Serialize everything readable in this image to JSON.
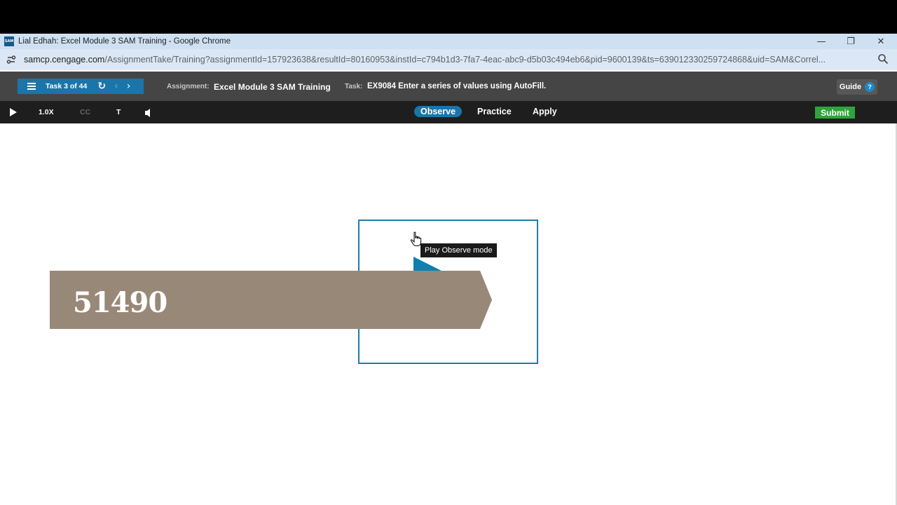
{
  "window": {
    "favicon_text": "SAM",
    "title": "Lial Edhah: Excel Module 3 SAM Training - Google Chrome",
    "minimize": "—",
    "restore": "❐",
    "close": "✕"
  },
  "address": {
    "host": "samcp.cengage.com",
    "path": "/AssignmentTake/Training?assignmentId=157923638&resultId=80160953&instId=c794b1d3-7fa7-4eac-abc9-d5b03c494eb6&pid=9600139&ts=639012330259724868&uid=SAM&Correl..."
  },
  "sam_header": {
    "task_label": "Task 3 of 44",
    "reset_icon": "↻",
    "prev_icon": "‹",
    "next_icon": "›",
    "assignment_label": "Assignment:",
    "assignment_value": "Excel Module 3 SAM Training",
    "task_key": "Task:",
    "task_value": "EX9084 Enter a series of values using AutoFill.",
    "guide_label": "Guide",
    "guide_q": "?"
  },
  "controls": {
    "speed": "1.0X",
    "cc": "CC",
    "t": "T",
    "modes": [
      "Observe",
      "Practice",
      "Apply"
    ],
    "active_mode": "Observe",
    "submit": "Submit"
  },
  "content": {
    "tooltip": "Play Observe mode",
    "banner_value": "51490",
    "colors": {
      "play": "#0f7fb0",
      "frame": "#1f7ea6",
      "banner": "#988878"
    }
  }
}
